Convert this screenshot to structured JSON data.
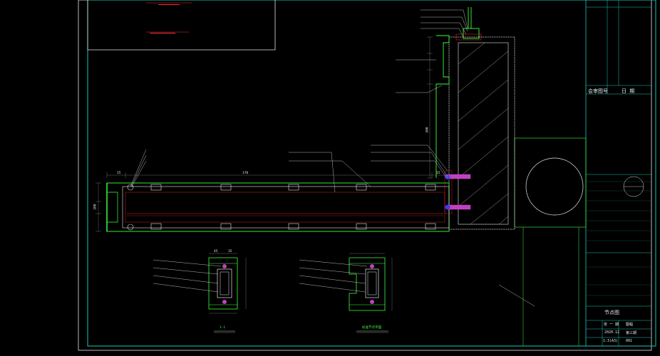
{
  "title_block": {
    "row_labels": [
      "会审图号",
      "日 期"
    ],
    "bottom_labels": [
      "张 一 期",
      "图幅",
      "第三期",
      "节点图"
    ],
    "date": "2020.12",
    "scale": "1:3(A3)",
    "sheet_no": "001"
  },
  "section_labels": [
    "1-1",
    "标准节点平面"
  ],
  "dimensions": [
    "15",
    "170",
    "200",
    "45",
    "35"
  ]
}
